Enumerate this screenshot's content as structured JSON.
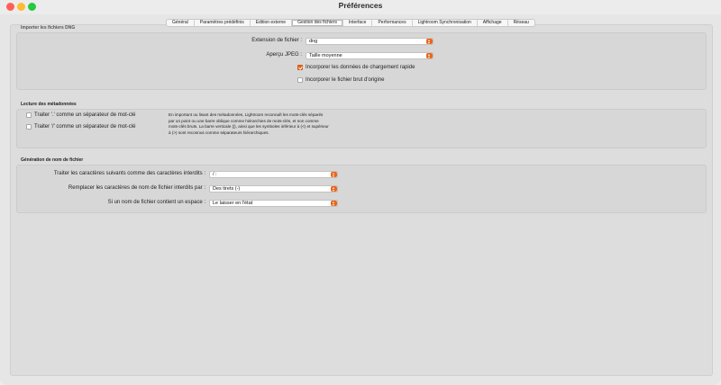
{
  "window": {
    "title": "Préférences"
  },
  "tabs": [
    {
      "label": "Général",
      "active": false
    },
    {
      "label": "Paramètres prédéfinis",
      "active": false
    },
    {
      "label": "Edition externe",
      "active": false
    },
    {
      "label": "Gestion des fichiers",
      "active": true
    },
    {
      "label": "Interface",
      "active": false
    },
    {
      "label": "Performances",
      "active": false
    },
    {
      "label": "Lightroom Synchronisation",
      "active": false
    },
    {
      "label": "Affichage",
      "active": false
    },
    {
      "label": "Réseau",
      "active": false
    }
  ],
  "dng": {
    "section_label": "Importer les fichiers DNG",
    "extension_label": "Extension de fichier :",
    "extension_value": "dng",
    "preview_label": "Aperçu JPEG :",
    "preview_value": "Taille moyenne",
    "fast_load": {
      "label": "Incorporer les données de chargement rapide",
      "checked": true
    },
    "embed_raw": {
      "label": "Incorporer le fichier brut d'origine",
      "checked": false
    }
  },
  "metadata": {
    "section_label": "Lecture des métadonnées",
    "dot_separator": {
      "label": "Traiter '.' comme un séparateur de mot-clé",
      "checked": false
    },
    "slash_separator": {
      "label": "Traiter '/' comme un séparateur de mot-clé",
      "checked": false
    },
    "description": "En important ou lisant des métadonnées, Lightroom reconnaît les mots-clés séparés par un point ou une barre oblique comme hiérarchies de mots-clés, et non comme mots-clés bruts. La barre verticale (|), ainsi que les symboles inférieur à (<) et supérieur à (>) sont reconnus comme séparateurs hiérarchiques."
  },
  "filename": {
    "section_label": "Génération de nom de fichier",
    "illegal_label": "Traiter les caractères suivants comme des caractères interdits :",
    "illegal_value": "/ :",
    "replace_label": "Remplacer les caractères de nom de fichier interdits par :",
    "replace_value": "Des tirets (-)",
    "space_label": "Si un nom de fichier contient un espace :",
    "space_value": "Le laisser en l'état"
  },
  "colors": {
    "accent": "#e8661e"
  }
}
